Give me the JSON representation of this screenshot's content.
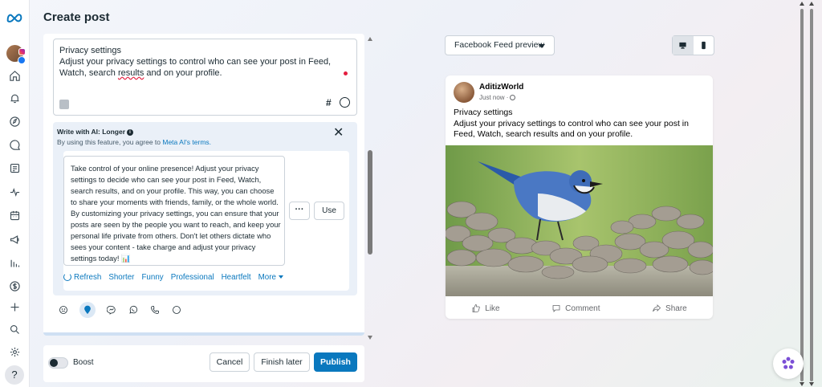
{
  "app": {
    "logo_icon": "meta-logo-icon",
    "page_title": "Create post",
    "colors": {
      "accent": "#0a78be",
      "primary_button": "#0a78be",
      "text": "#1c2b33"
    }
  },
  "leftnav": {
    "items": [
      {
        "name": "home-icon"
      },
      {
        "name": "notifications-bell-icon"
      },
      {
        "name": "compass-icon"
      },
      {
        "name": "messages-icon"
      },
      {
        "name": "content-icon"
      },
      {
        "name": "insights-icon"
      },
      {
        "name": "calendar-icon"
      },
      {
        "name": "ads-megaphone-icon"
      },
      {
        "name": "analytics-bars-icon"
      },
      {
        "name": "monetization-dollar-icon"
      },
      {
        "name": "create-plus-icon"
      },
      {
        "name": "search-icon"
      },
      {
        "name": "settings-gear-icon"
      }
    ],
    "help_label": "?"
  },
  "composer": {
    "post_text_line1": "Privacy settings",
    "post_text_line2_before_underline": "Adjust your privacy settings to control who can see your post in Feed, Watch, search ",
    "post_text_underlined": "results",
    "post_text_line2_after_underline": " and on your profile.",
    "hashtag_label": "#"
  },
  "ai_panel": {
    "title": "Write with AI: Longer",
    "terms_prefix": "By using this feature, you agree to ",
    "terms_link": "Meta AI's terms.",
    "close_label": "✕",
    "suggestion": "Take control of your online presence! Adjust your privacy settings to decide who can see your post in Feed, Watch, search results, and on your profile. This way, you can choose to share your moments with friends, family, or the whole world. By customizing your privacy settings, you can ensure that your posts are seen by the people you want to reach, and keep your personal life private from others. Don't let others dictate who sees your content - take charge and adjust your privacy settings today! 📊",
    "more_label": "···",
    "use_label": "Use",
    "tones": [
      "Refresh",
      "Shorter",
      "Funny",
      "Professional",
      "Heartfelt",
      "More"
    ]
  },
  "attachments": [
    "emoji-icon",
    "location-pin-icon",
    "messenger-icon",
    "whatsapp-icon",
    "phone-icon",
    "more-options-icon"
  ],
  "footer": {
    "boost_label": "Boost",
    "boost_on": false,
    "cancel_label": "Cancel",
    "finish_later_label": "Finish later",
    "publish_label": "Publish"
  },
  "preview": {
    "selector_label": "Facebook Feed preview",
    "devices": [
      "desktop-icon",
      "mobile-icon"
    ],
    "author": "AditizWorld",
    "time": "Just now ·",
    "text_line1": "Privacy settings",
    "text_line2": "Adjust your privacy settings to control who can see your post in Feed, Watch, search results and on your profile.",
    "actions": [
      {
        "label": "Like",
        "icon": "like-thumb-icon"
      },
      {
        "label": "Comment",
        "icon": "comment-icon"
      },
      {
        "label": "Share",
        "icon": "share-icon"
      }
    ]
  }
}
